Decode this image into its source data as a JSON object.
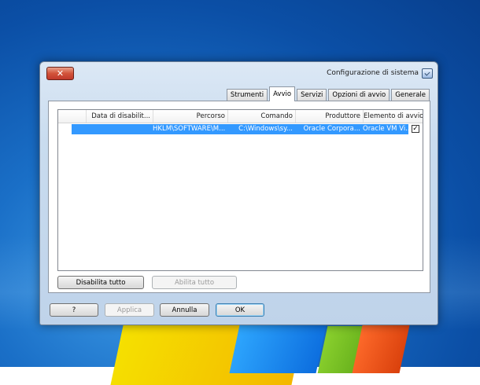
{
  "window": {
    "title": "Configurazione di sistema",
    "close_glyph": "✕",
    "title_icon": "msconfig-icon"
  },
  "tabs": [
    {
      "label": "Generale",
      "active": false
    },
    {
      "label": "Opzioni di avvio",
      "active": false
    },
    {
      "label": "Servizi",
      "active": false
    },
    {
      "label": "Avvio",
      "active": true
    },
    {
      "label": "Strumenti",
      "active": false
    }
  ],
  "startup_table": {
    "columns": [
      "Elemento di avvio",
      "Produttore",
      "Comando",
      "Percorso",
      "Data di disabilit..."
    ],
    "rows": [
      {
        "checked": true,
        "checkmark": "✓",
        "cells": [
          "Oracle VM Vi...",
          "Oracle Corpora...",
          "C:\\Windows\\sy...",
          "HKLM\\SOFTWARE\\M...",
          ""
        ]
      }
    ]
  },
  "buttons": {
    "enable_all": "Abilita tutto",
    "disable_all": "Disabilita tutto",
    "ok": "OK",
    "cancel": "Annulla",
    "apply": "Applica",
    "help": "?"
  },
  "colors": {
    "selection": "#3399ff",
    "close_button": "#c0392b"
  }
}
